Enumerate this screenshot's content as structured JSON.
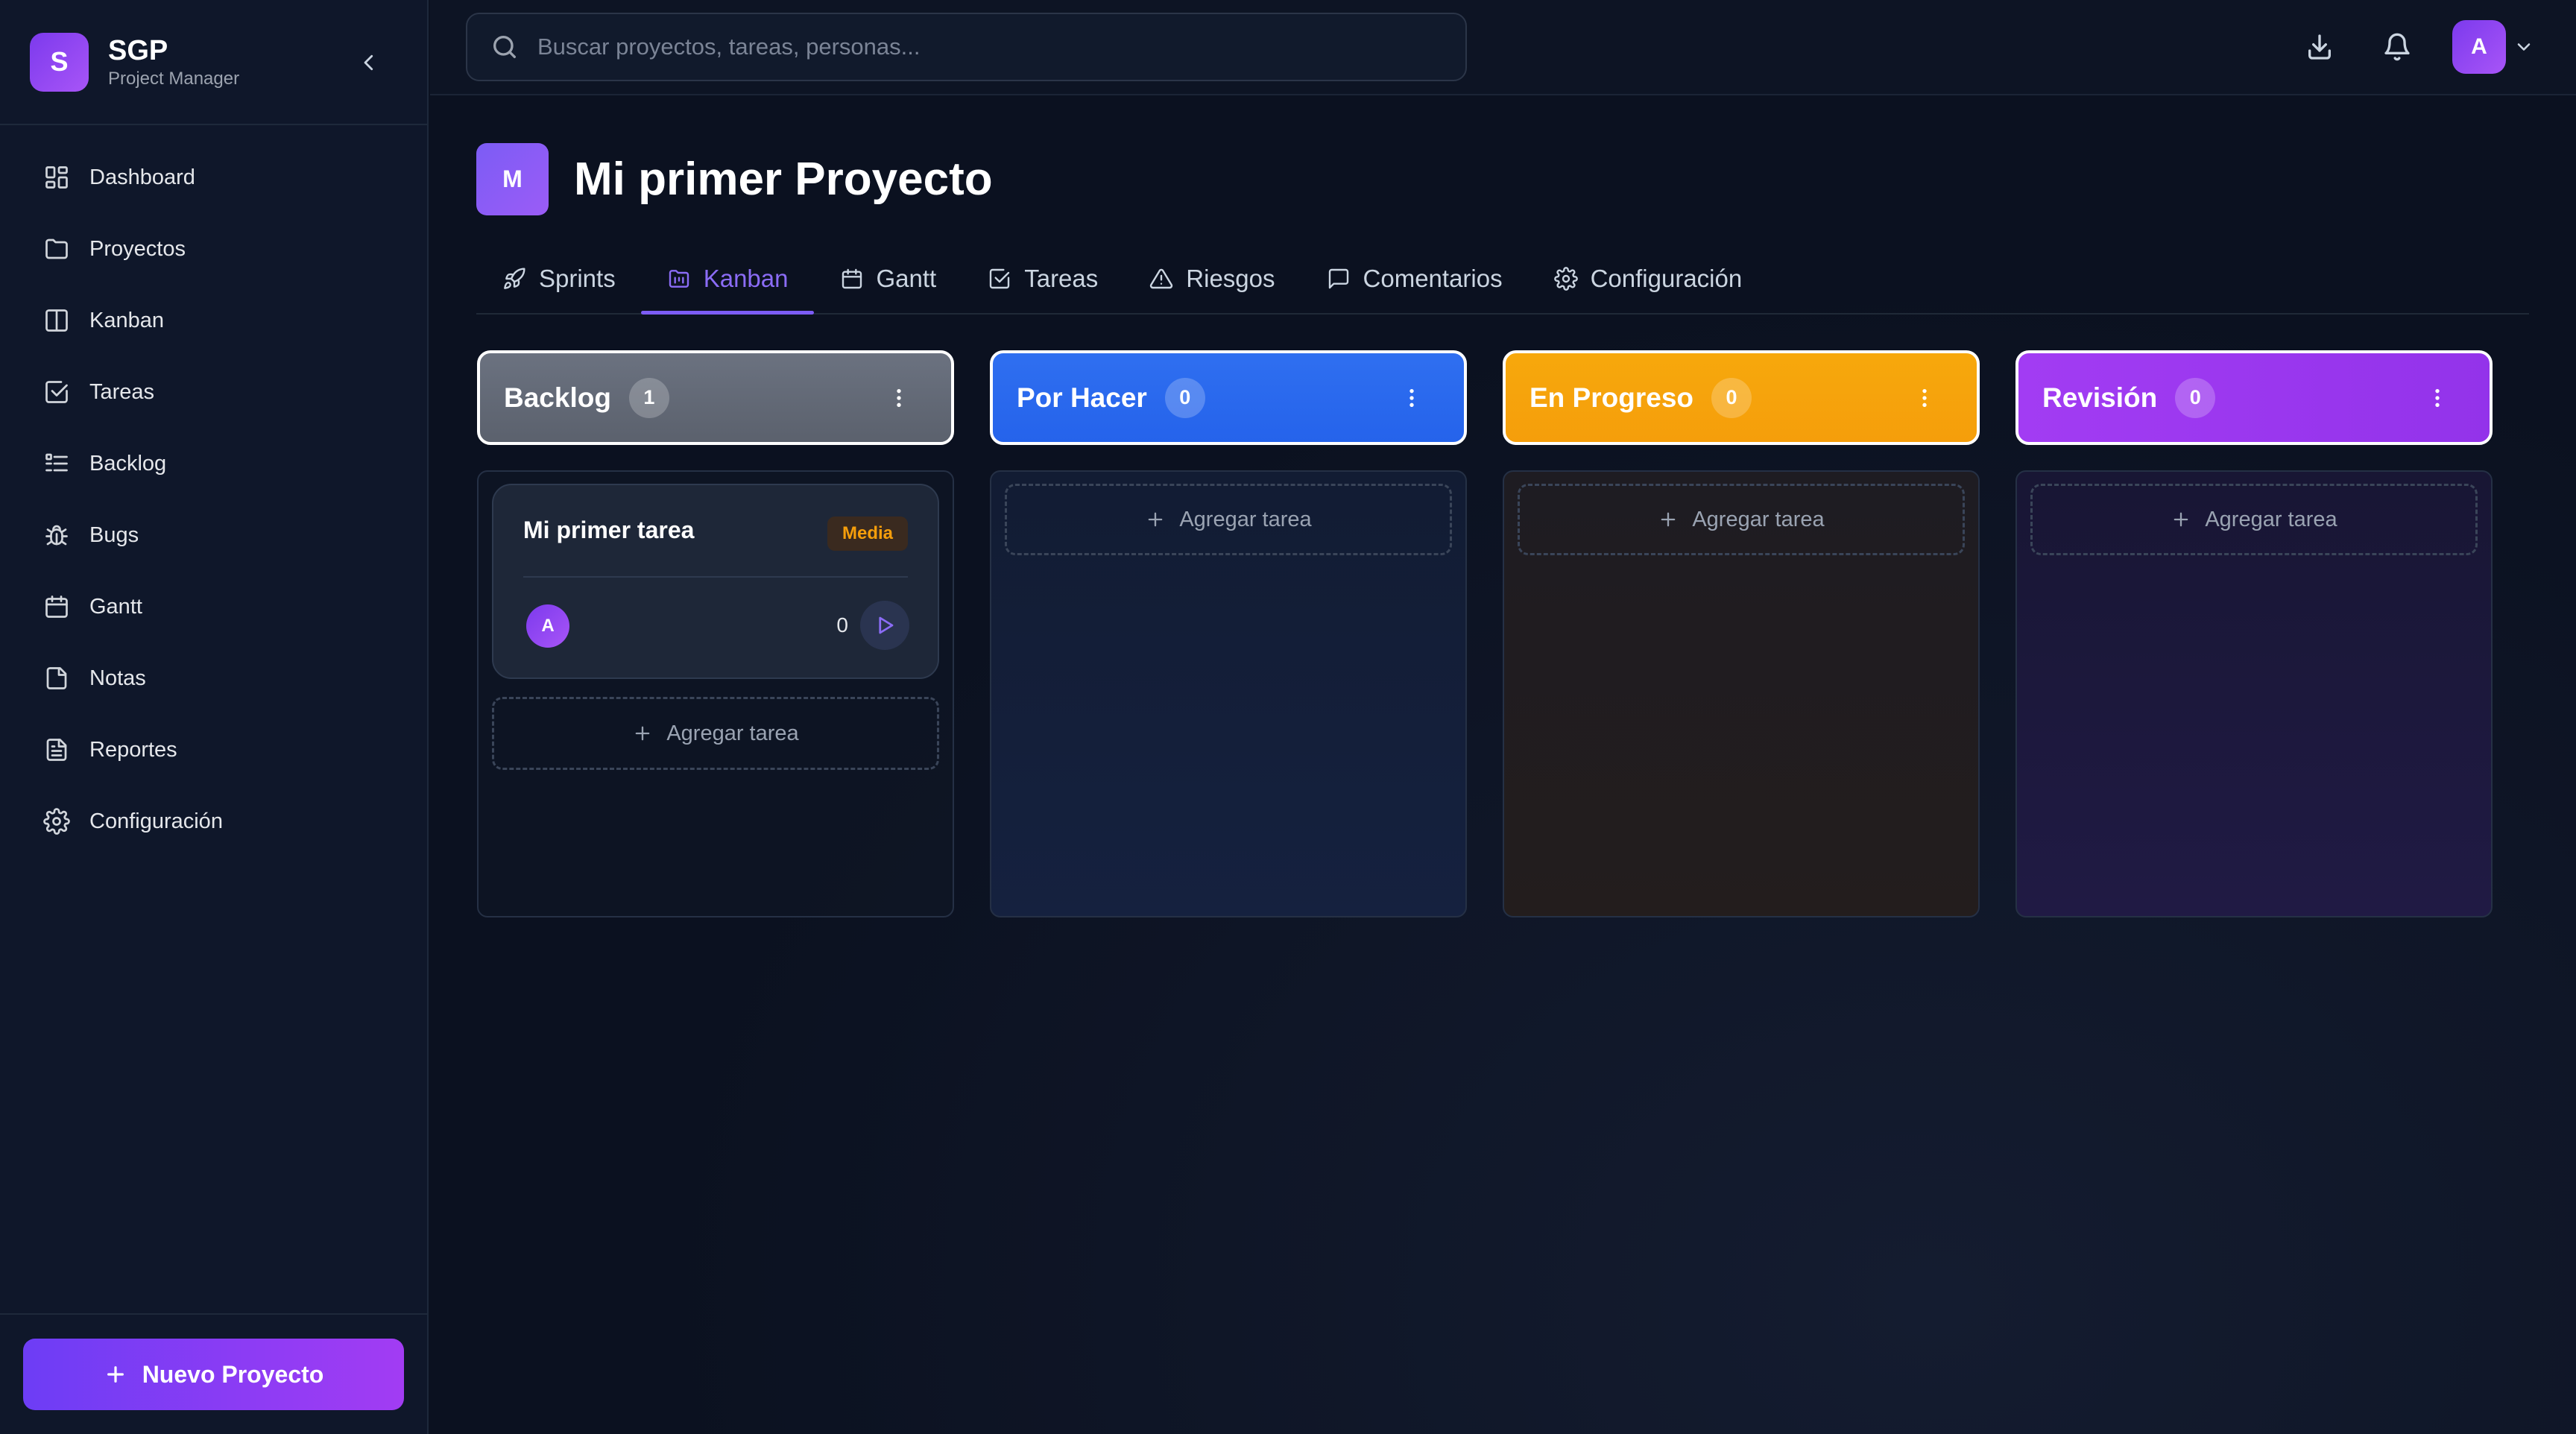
{
  "brand": {
    "logo_letter": "S",
    "name": "SGP",
    "subtitle": "Project Manager"
  },
  "sidebar": {
    "items": [
      {
        "label": "Dashboard",
        "icon": "dashboard-icon"
      },
      {
        "label": "Proyectos",
        "icon": "folder-icon"
      },
      {
        "label": "Kanban",
        "icon": "columns-icon"
      },
      {
        "label": "Tareas",
        "icon": "checkbox-icon"
      },
      {
        "label": "Backlog",
        "icon": "list-icon"
      },
      {
        "label": "Bugs",
        "icon": "bug-icon"
      },
      {
        "label": "Gantt",
        "icon": "calendar-icon"
      },
      {
        "label": "Notas",
        "icon": "note-icon"
      },
      {
        "label": "Reportes",
        "icon": "report-icon"
      },
      {
        "label": "Configuración",
        "icon": "gear-icon"
      }
    ],
    "new_project_label": "Nuevo Proyecto"
  },
  "topbar": {
    "search_placeholder": "Buscar proyectos, tareas, personas...",
    "user_initial": "A"
  },
  "project": {
    "avatar_letter": "M",
    "title": "Mi primer Proyecto"
  },
  "tabs": [
    {
      "label": "Sprints",
      "icon": "rocket-icon"
    },
    {
      "label": "Kanban",
      "icon": "kanban-icon",
      "active": true
    },
    {
      "label": "Gantt",
      "icon": "calendar-icon"
    },
    {
      "label": "Tareas",
      "icon": "checkbox-icon"
    },
    {
      "label": "Riesgos",
      "icon": "warning-icon"
    },
    {
      "label": "Comentarios",
      "icon": "comment-icon"
    },
    {
      "label": "Configuración",
      "icon": "gear-icon"
    }
  ],
  "columns": [
    {
      "title": "Backlog",
      "count": "1",
      "color": "#6b7280",
      "add_label": "Agregar tarea"
    },
    {
      "title": "Por Hacer",
      "count": "0",
      "color": "#2563eb",
      "add_label": "Agregar tarea"
    },
    {
      "title": "En Progreso",
      "count": "0",
      "color": "#f59e0b",
      "add_label": "Agregar tarea"
    },
    {
      "title": "Revisión",
      "count": "0",
      "color": "#a234f0",
      "add_label": "Agregar tarea"
    }
  ],
  "task": {
    "title": "Mi primer tarea",
    "priority": "Media",
    "assignee_initial": "A",
    "count": "0"
  },
  "colors": {
    "accent": "#7c5cf5",
    "background": "#0b1120",
    "sidebar": "#0f172a",
    "priority_medium": "#f59e0b"
  }
}
